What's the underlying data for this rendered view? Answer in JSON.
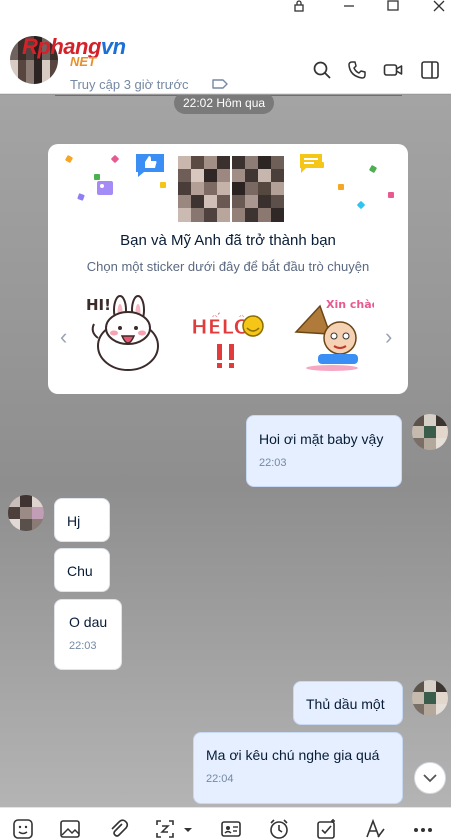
{
  "header": {
    "watermark_main": "Rphang",
    "watermark_vn": "vn",
    "watermark_net": "NET",
    "last_seen": "Truy cập 3 giờ trước"
  },
  "chat": {
    "time_divider": "22:02 Hôm qua",
    "friend_card": {
      "title": "Bạn và Mỹ Anh đã trở thành bạn",
      "subtitle": "Chọn một sticker dưới đây để bắt đầu trò chuyện",
      "stickers": [
        {
          "name": "hi-sticker",
          "text": "HI!"
        },
        {
          "name": "hello-sticker",
          "text": "HẾLÔ"
        },
        {
          "name": "xin-chao-sticker",
          "text": "Xin chào"
        }
      ]
    },
    "messages": [
      {
        "side": "me",
        "text": "Hoi ơi mặt baby vậy",
        "time": "22:03"
      },
      {
        "side": "them",
        "text": "Hj",
        "time": ""
      },
      {
        "side": "them",
        "text": "Chu",
        "time": ""
      },
      {
        "side": "them",
        "text": "O dau",
        "time": "22:03"
      },
      {
        "side": "me",
        "text": "Thủ dầu một",
        "time": ""
      },
      {
        "side": "me",
        "text": "Ma ơi kêu chú nghe gia quá",
        "time": "22:04"
      }
    ]
  },
  "colors": {
    "accent": "#0068ff",
    "my_bubble": "#e5efff",
    "their_bubble": "#ffffff"
  }
}
